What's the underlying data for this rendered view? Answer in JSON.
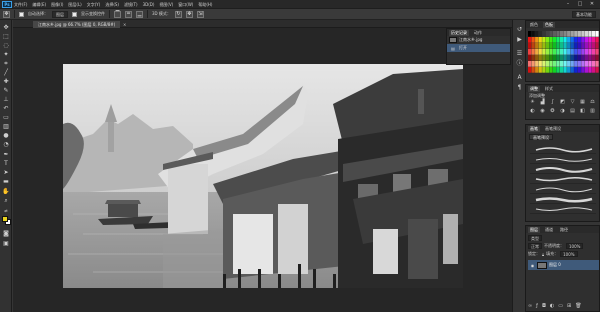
{
  "app": {
    "logo": "Ps",
    "menu": [
      "文件(F)",
      "编辑(E)",
      "图像(I)",
      "图层(L)",
      "文字(Y)",
      "选择(S)",
      "滤镜(T)",
      "3D(D)",
      "视图(V)",
      "窗口(W)",
      "帮助(H)"
    ],
    "window_controls": [
      "–",
      "□",
      "✕"
    ]
  },
  "options_bar": {
    "auto_select_label": "自动选择：",
    "auto_select_target": "图层",
    "show_transform_label": "显示变换控件",
    "mode_3d_label": "3D 模式：",
    "workspace": "基本功能"
  },
  "document": {
    "tab_label": "江南水乡.jpg @ 66.7% (图层 0, RGB/8#)",
    "close_glyph": "×"
  },
  "history_panel": {
    "tabs": [
      "历史记录",
      "动作"
    ],
    "rows": [
      "江南水乡.jpg",
      "打开"
    ]
  },
  "swatches_panel": {
    "tabs": [
      "颜色",
      "色板"
    ]
  },
  "adjust_panel": {
    "tabs": [
      "调整",
      "样式"
    ],
    "subtitle": "添加调整"
  },
  "brush_panel": {
    "tabs": [
      "画笔",
      "画笔预设"
    ],
    "button": "画笔预设"
  },
  "layers_panel": {
    "tabs": [
      "图层",
      "通道",
      "路径"
    ],
    "kind": "类型",
    "blend_mode": "正常",
    "opacity_label": "不透明度：",
    "opacity_value": "100%",
    "lock_label": "锁定：",
    "fill_label": "填充：",
    "fill_value": "100%",
    "layer_name": "图层 0"
  },
  "colors": {
    "foreground": "#e8d21e",
    "background": "#ffffff",
    "selection": "#3f5a7a"
  },
  "icons": {
    "tools": [
      "move-icon",
      "marquee-icon",
      "lasso-icon",
      "magic-wand-icon",
      "crop-icon",
      "eyedropper-icon",
      "healing-brush-icon",
      "brush-icon",
      "clone-stamp-icon",
      "history-brush-icon",
      "eraser-icon",
      "gradient-icon",
      "blur-icon",
      "dodge-icon",
      "pen-icon",
      "type-icon",
      "path-selection-icon",
      "shape-icon",
      "hand-icon",
      "zoom-icon"
    ]
  }
}
